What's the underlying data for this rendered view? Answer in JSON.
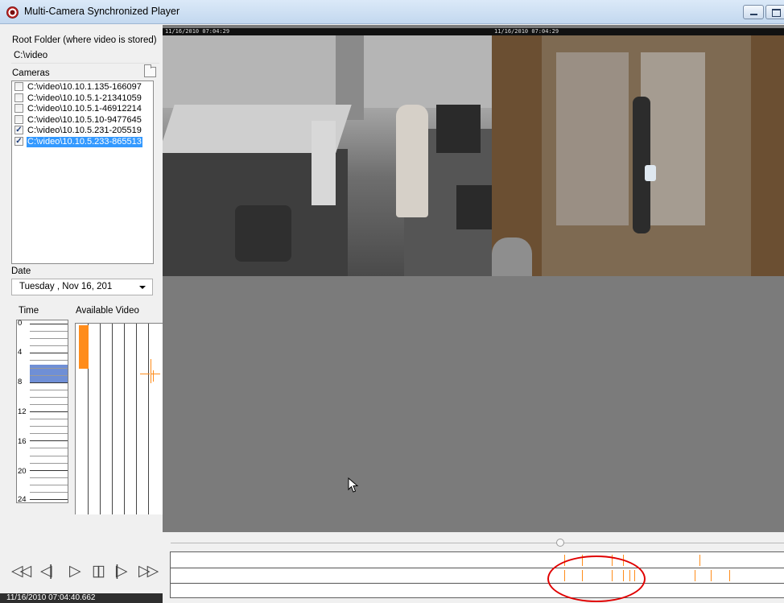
{
  "window": {
    "title": "Multi-Camera Synchronized Player"
  },
  "left_panel": {
    "root_label": "Root Folder (where video is stored)",
    "root_value": "C:\\video",
    "cameras_label": "Cameras",
    "cameras": [
      {
        "path": "C:\\video\\10.10.1.135-166097",
        "checked": false,
        "selected": false
      },
      {
        "path": "C:\\video\\10.10.5.1-21341059",
        "checked": false,
        "selected": false
      },
      {
        "path": "C:\\video\\10.10.5.1-46912214",
        "checked": false,
        "selected": false
      },
      {
        "path": "C:\\video\\10.10.5.10-9477645",
        "checked": false,
        "selected": false
      },
      {
        "path": "C:\\video\\10.10.5.231-205519",
        "checked": true,
        "selected": false
      },
      {
        "path": "C:\\video\\10.10.5.233-865513",
        "checked": true,
        "selected": true
      }
    ],
    "date_label": "Date",
    "date_value": "Tuesday  , Nov 16, 201",
    "time_label": "Time",
    "available_label": "Available Video",
    "time_ticks": [
      "0",
      "4",
      "8",
      "12",
      "16",
      "20",
      "24"
    ],
    "timestamp": "11/16/2010 07:04:40.662"
  },
  "transport": {
    "rewind": "rewind",
    "step_back": "step-back",
    "play": "play",
    "pause": "pause",
    "step_forward": "step-forward",
    "fast_forward": "fast-forward"
  },
  "video": {
    "feed1_overlay": "11/16/2010 07:04:29",
    "feed2_overlay": "11/16/2010 07:04:29"
  },
  "colors": {
    "availability": "#ff8c1a",
    "time_highlight": "#6f8fd6",
    "annotation": "#e00000",
    "selection": "#3399ff"
  }
}
